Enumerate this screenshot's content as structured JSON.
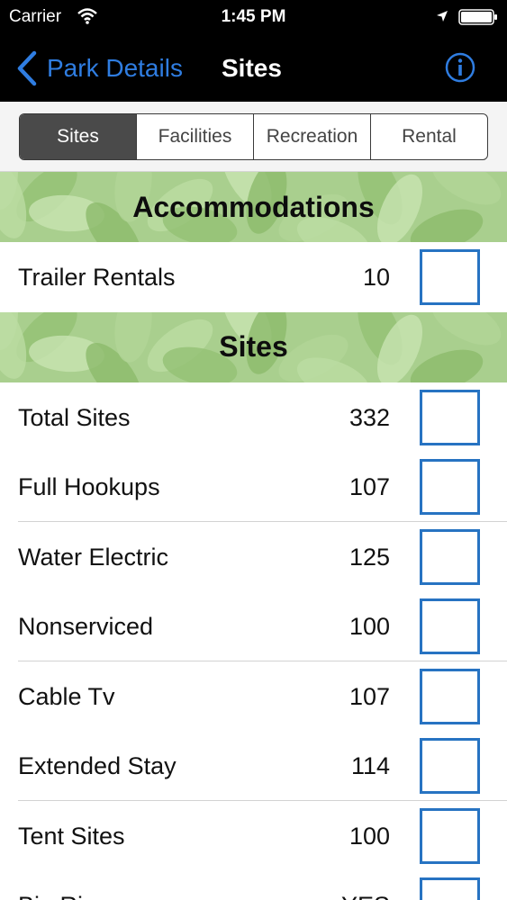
{
  "status": {
    "carrier": "Carrier",
    "time": "1:45 PM"
  },
  "nav": {
    "back_label": "Park Details",
    "title": "Sites",
    "info_icon": "info-icon"
  },
  "segments": [
    {
      "label": "Sites",
      "active": true
    },
    {
      "label": "Facilities",
      "active": false
    },
    {
      "label": "Recreation",
      "active": false
    },
    {
      "label": "Rental",
      "active": false
    }
  ],
  "sections": [
    {
      "title": "Accommodations",
      "rows": [
        {
          "label": "Trailer Rentals",
          "value": "10"
        }
      ]
    },
    {
      "title": "Sites",
      "rows": [
        {
          "label": "Total Sites",
          "value": "332"
        },
        {
          "label": "Full Hookups",
          "value": "107"
        },
        {
          "label": "Water Electric",
          "value": "125"
        },
        {
          "label": "Nonserviced",
          "value": "100"
        },
        {
          "label": "Cable Tv",
          "value": "107"
        },
        {
          "label": "Extended Stay",
          "value": "114"
        },
        {
          "label": "Tent Sites",
          "value": "100"
        },
        {
          "label": "Big Rigs",
          "value": "YES"
        }
      ]
    }
  ],
  "colors": {
    "accent": "#2f7de1",
    "checkbox_border": "#2773c2",
    "band": "#a9cf8e"
  }
}
